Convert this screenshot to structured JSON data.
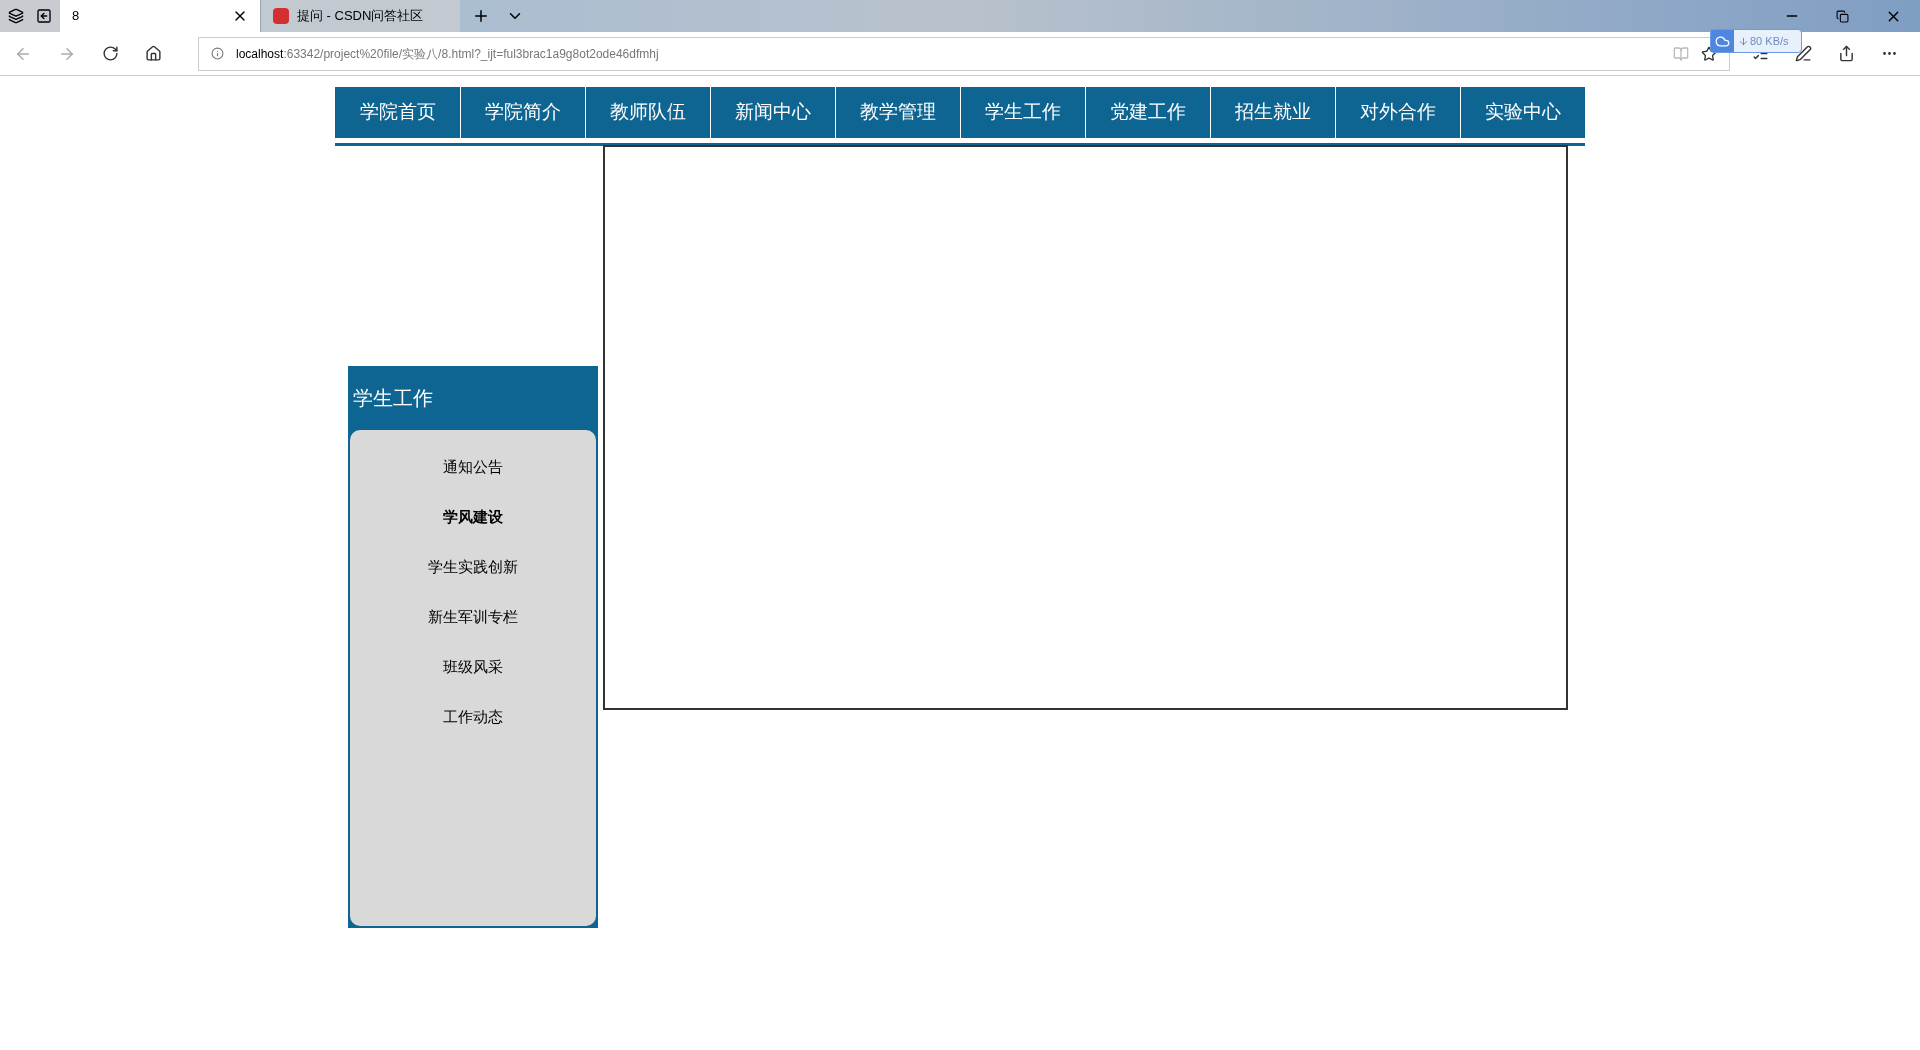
{
  "browser": {
    "tabs": [
      {
        "title": "8",
        "selected": true,
        "favicon": false
      },
      {
        "title": "提问 - CSDN问答社区",
        "selected": false,
        "favicon": true
      }
    ],
    "address": {
      "host": "localhost",
      "rest": ":63342/project%20file/实验八/8.html?_ijt=ful3brac1a9g8ot2ode46dfmhj"
    },
    "download_speed": "80 KB/s"
  },
  "nav": [
    {
      "label": "学院首页"
    },
    {
      "label": "学院简介"
    },
    {
      "label": "教师队伍"
    },
    {
      "label": "新闻中心"
    },
    {
      "label": "教学管理"
    },
    {
      "label": "学生工作"
    },
    {
      "label": "党建工作"
    },
    {
      "label": "招生就业"
    },
    {
      "label": "对外合作"
    },
    {
      "label": "实验中心"
    }
  ],
  "sidebar": {
    "title": "学生工作",
    "items": [
      {
        "label": "通知公告",
        "selected": false
      },
      {
        "label": "学风建设",
        "selected": true
      },
      {
        "label": "学生实践创新",
        "selected": false
      },
      {
        "label": "新生军训专栏",
        "selected": false
      },
      {
        "label": "班级风采",
        "selected": false
      },
      {
        "label": "工作动态",
        "selected": false
      }
    ]
  }
}
